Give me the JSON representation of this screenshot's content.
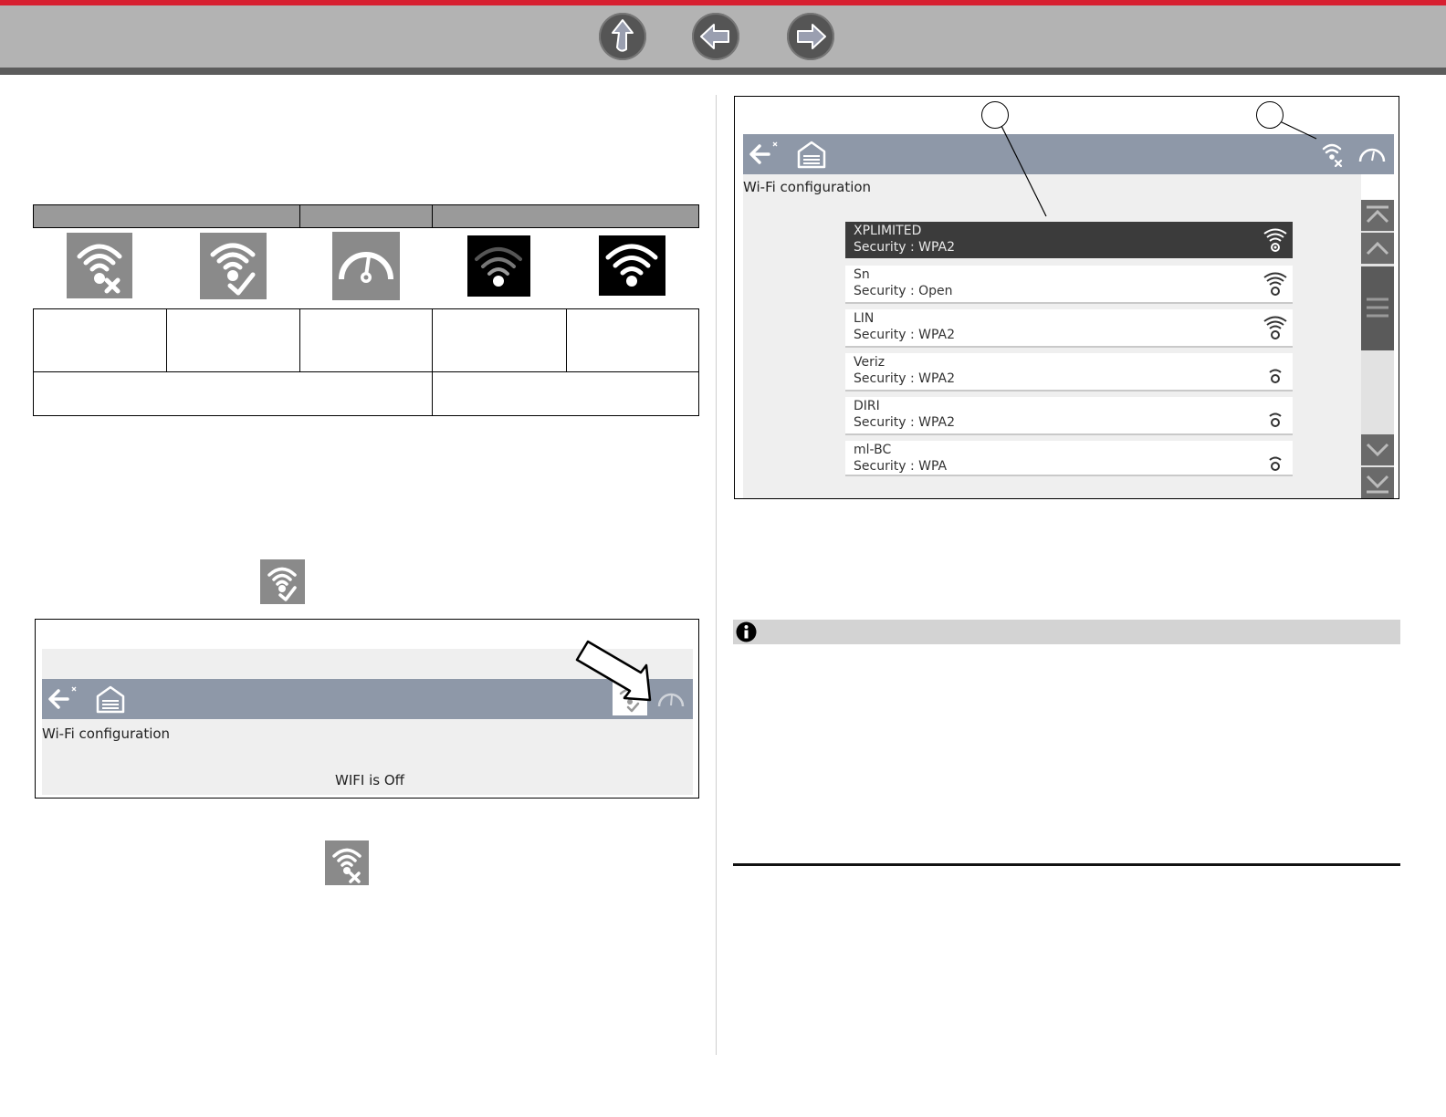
{
  "toolbar": {
    "buttons": [
      {
        "name": "up-arrow-button",
        "icon": "up-arrow-icon"
      },
      {
        "name": "back-arrow-button",
        "icon": "left-arrow-icon"
      },
      {
        "name": "forward-arrow-button",
        "icon": "right-arrow-icon"
      }
    ],
    "colors": {
      "accent": "#d71f30",
      "bar": "#b3b3b3"
    }
  },
  "icon_table": {
    "icons": [
      "wifi-off-icon",
      "wifi-on-icon",
      "gauge-icon",
      "wifi-signal-weak-icon",
      "wifi-signal-strong-icon"
    ]
  },
  "wifi_screen_large": {
    "title": "Wi-Fi configuration",
    "networks": [
      {
        "name": "XPLIMITED",
        "security": "Security : WPA2",
        "signal": 4,
        "selected": true
      },
      {
        "name": "Sn",
        "security": "Security : Open",
        "signal": 4,
        "selected": false
      },
      {
        "name": "LIN",
        "security": "Security : WPA2",
        "signal": 4,
        "selected": false
      },
      {
        "name": "Veriz",
        "security": "Security : WPA2",
        "signal": 1,
        "selected": false
      },
      {
        "name": "DIRI",
        "security": "Security : WPA2",
        "signal": 1,
        "selected": false
      },
      {
        "name": "ml-BC",
        "security": "Security : WPA",
        "signal": 1,
        "selected": false
      }
    ]
  },
  "wifi_screen_small": {
    "title": "Wi-Fi configuration",
    "status": "WIFI is Off"
  }
}
